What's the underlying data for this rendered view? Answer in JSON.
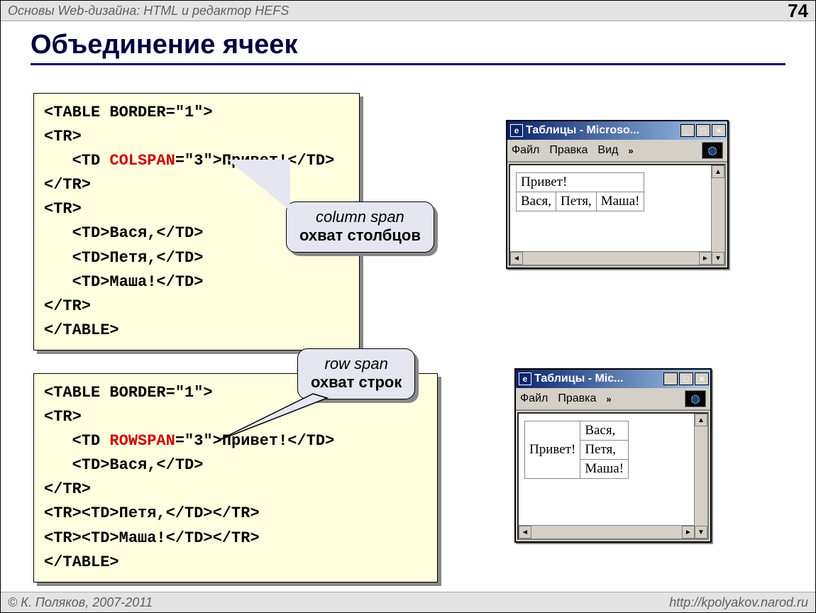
{
  "header": {
    "title": "Основы Web-дизайна: HTML и редактор HEFS",
    "page": "74"
  },
  "slide_title": "Объединение ячеек",
  "code1": {
    "l1": "<TABLE BORDER=\"1\">",
    "l2": "<TR>",
    "l3a": "   <TD ",
    "l3b": "COLSPAN",
    "l3c": "=\"3\">Привет!</TD>",
    "l4": "</TR>",
    "l5": "<TR>",
    "l6": "   <TD>Вася,</TD>",
    "l7": "   <TD>Петя,</TD>",
    "l8": "   <TD>Маша!</TD>",
    "l9": "</TR>",
    "l10": "</TABLE>"
  },
  "code2": {
    "l1": "<TABLE BORDER=\"1\">",
    "l2": "<TR>",
    "l3a": "   <TD ",
    "l3b": "ROWSPAN",
    "l3c": "=\"3\">Привет!</TD>",
    "l4": "   <TD>Вася,</TD>",
    "l5": "</TR>",
    "l6": "<TR><TD>Петя,</TD></TR>",
    "l7": "<TR><TD>Маша!</TD></TR>",
    "l8": "</TABLE>"
  },
  "callout1": {
    "en": "column span",
    "ru": "охват столбцов"
  },
  "callout2": {
    "en": "row span",
    "ru": "охват строк"
  },
  "browser1": {
    "title": "Таблицы - Microso...",
    "menu": {
      "file": "Файл",
      "edit": "Правка",
      "view": "Вид"
    },
    "table": {
      "r1c1": "Привет!",
      "r2c1": "Вася,",
      "r2c2": "Петя,",
      "r2c3": "Маша!"
    }
  },
  "browser2": {
    "title": "Таблицы - Mic...",
    "menu": {
      "file": "Файл",
      "edit": "Правка"
    },
    "table": {
      "c1": "Привет!",
      "r1": "Вася,",
      "r2": "Петя,",
      "r3": "Маша!"
    }
  },
  "footer": {
    "left": "© К. Поляков, 2007-2011",
    "right": "http://kpolyakov.narod.ru"
  }
}
